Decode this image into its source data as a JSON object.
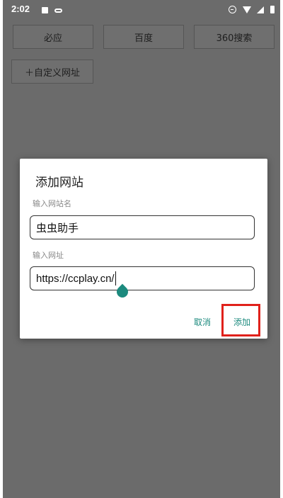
{
  "status_bar": {
    "time": "2:02"
  },
  "engines": [
    {
      "label": "必应"
    },
    {
      "label": "百度"
    },
    {
      "label": "360搜索"
    }
  ],
  "custom_url_button": {
    "label": "＋自定义网址"
  },
  "dialog": {
    "title": "添加网站",
    "name_label": "输入网站名",
    "name_value": "虫虫助手",
    "url_label": "输入网址",
    "url_value": "https://ccplay.cn/",
    "cancel_label": "取消",
    "add_label": "添加"
  },
  "colors": {
    "accent": "#1c8a7e",
    "highlight": "#e0211b",
    "overlay": "#6b6b6b"
  }
}
